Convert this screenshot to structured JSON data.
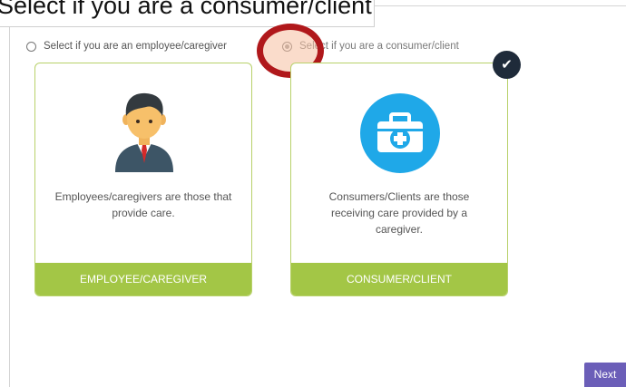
{
  "callout": {
    "text": "Select if you are a consumer/client"
  },
  "options": {
    "employee": {
      "radio_label": "Select if you are an employee/caregiver",
      "selected": false
    },
    "consumer": {
      "radio_label": "Select if you are a consumer/client",
      "selected": true
    }
  },
  "cards": {
    "employee": {
      "description": "Employees/caregivers are those that provide care.",
      "footer_label": "EMPLOYEE/CAREGIVER",
      "icon": "person-avatar-icon"
    },
    "consumer": {
      "description": "Consumers/Clients are those receiving care provided by a caregiver.",
      "footer_label": "CONSUMER/CLIENT",
      "icon": "medical-kit-icon",
      "checked": true
    }
  },
  "next_button": {
    "label": "Next"
  },
  "colors": {
    "accent_green": "#a3c646",
    "card_border": "#b8d16a",
    "medkit_blue": "#1fa8e8",
    "badge_dark": "#1f2b3a",
    "next_purple": "#6b5eb8",
    "highlight_red": "#b0181b"
  }
}
